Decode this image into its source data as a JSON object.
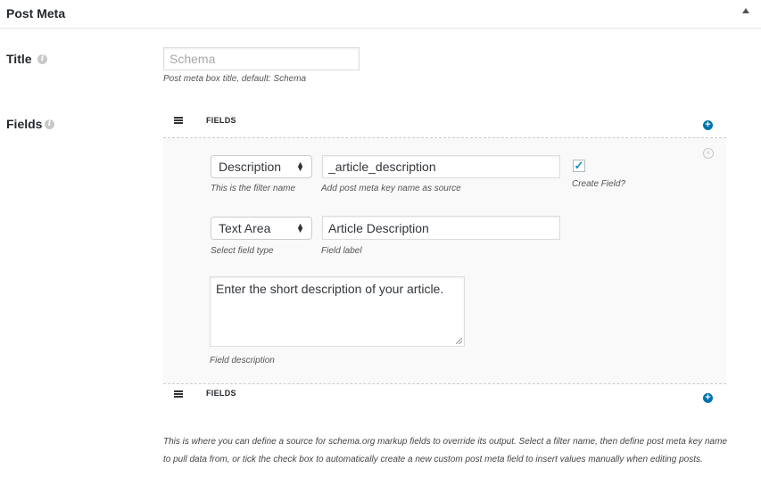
{
  "header": {
    "title": "Post Meta",
    "toggle_icon": "arrow-up-icon"
  },
  "title_row": {
    "label": "Title",
    "input_placeholder": "Schema",
    "help": "Post meta box title, default: Schema"
  },
  "fields_row": {
    "label": "Fields",
    "repeater_header": "FIELDS",
    "repeater_footer": "FIELDS",
    "item": {
      "filter_select": "Description",
      "filter_help": "This is the filter name",
      "meta_key_value": "_article_description",
      "meta_key_help": "Add post meta key name as source",
      "create_field_checked": true,
      "create_field_label": "Create Field?",
      "type_select": "Text Area",
      "type_help": "Select field type",
      "label_value": "Article Description",
      "label_help": "Field label",
      "description_value": "Enter the short description of your article.",
      "description_help": "Field description"
    }
  },
  "footnote": "This is where you can define a source for schema.org markup fields to override its output. Select a filter name, then define post meta key name to pull data from, or tick the check box to automatically create a new custom post meta field to insert values manually when editing posts.",
  "colors": {
    "accent": "#0073aa",
    "check": "#1e8cbe",
    "panel_bg": "#f9f9f9"
  }
}
